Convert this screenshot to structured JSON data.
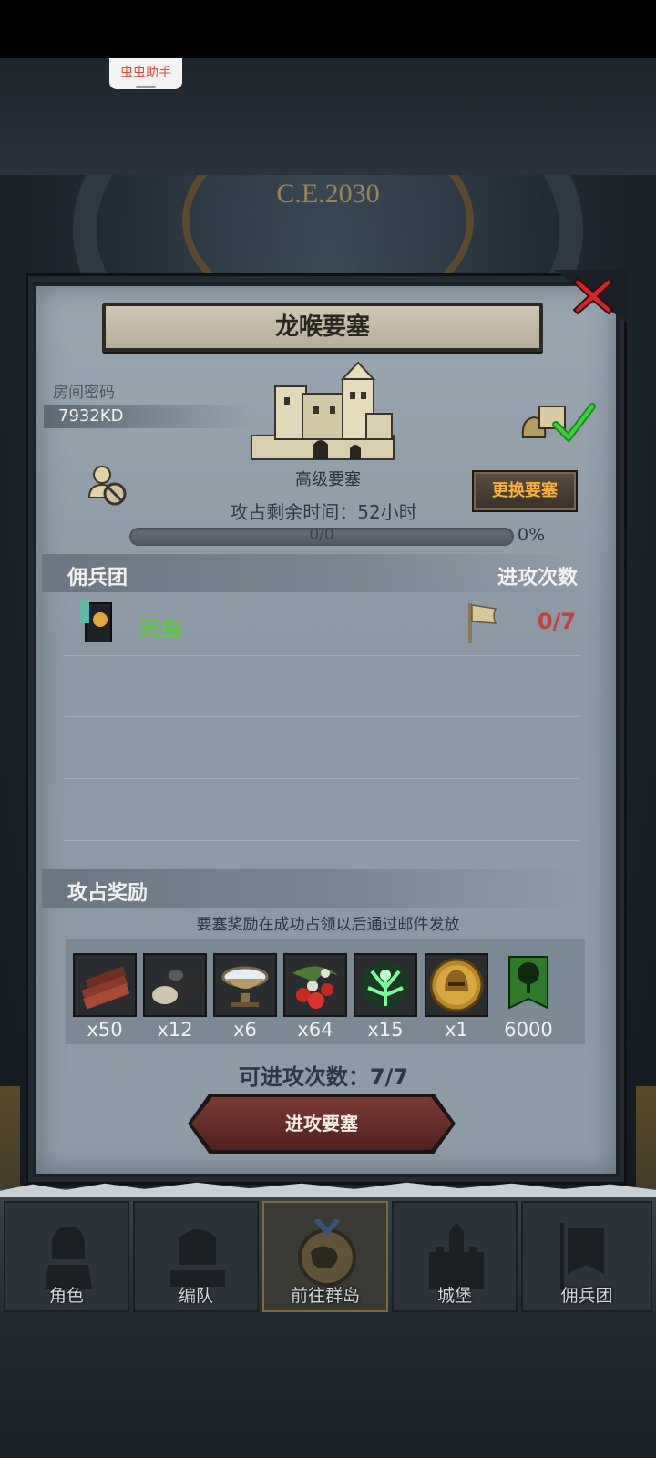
{
  "system": {
    "helper_label": "虫虫助手"
  },
  "background": {
    "era_text": "C.E.2030"
  },
  "dialog": {
    "title": "龙喉要塞",
    "room_password_label": "房间密码",
    "room_password": "7932KD",
    "fortress_level": "高级要塞",
    "time_label": "攻占剩余时间：",
    "time_value": "52小时",
    "change_button": "更换要塞",
    "progress_text": "0/0",
    "progress_percent": "0%",
    "progress_fraction": 0
  },
  "mercenary_section": {
    "header_left": "佣兵团",
    "header_right": "进攻次数",
    "rows": [
      {
        "name": "天虫",
        "attacks": "0/7"
      }
    ]
  },
  "rewards": {
    "header": "攻占奖励",
    "note": "要塞奖励在成功占领以后通过邮件发放",
    "items": [
      {
        "icon": "wood-planks-icon",
        "qty": "x50"
      },
      {
        "icon": "stone-ore-icon",
        "qty": "x12"
      },
      {
        "icon": "silver-bowl-icon",
        "qty": "x6"
      },
      {
        "icon": "berries-icon",
        "qty": "x64"
      },
      {
        "icon": "green-spirit-icon",
        "qty": "x15"
      },
      {
        "icon": "golden-helmet-coin-icon",
        "qty": "x1"
      },
      {
        "icon": "tree-banner-icon",
        "qty": "6000"
      }
    ]
  },
  "attack_count_label": "可进攻次数：7/7",
  "attack_button": "进攻要塞",
  "nav": [
    {
      "label": "角色",
      "active": false
    },
    {
      "label": "编队",
      "active": false
    },
    {
      "label": "前往群岛",
      "active": true
    },
    {
      "label": "城堡",
      "active": false
    },
    {
      "label": "佣兵团",
      "active": false
    }
  ],
  "colors": {
    "accent_orange": "#f4b13c",
    "merc_green": "#5ec93e",
    "count_red": "#c4413b",
    "panel": "#9aa6b0"
  }
}
